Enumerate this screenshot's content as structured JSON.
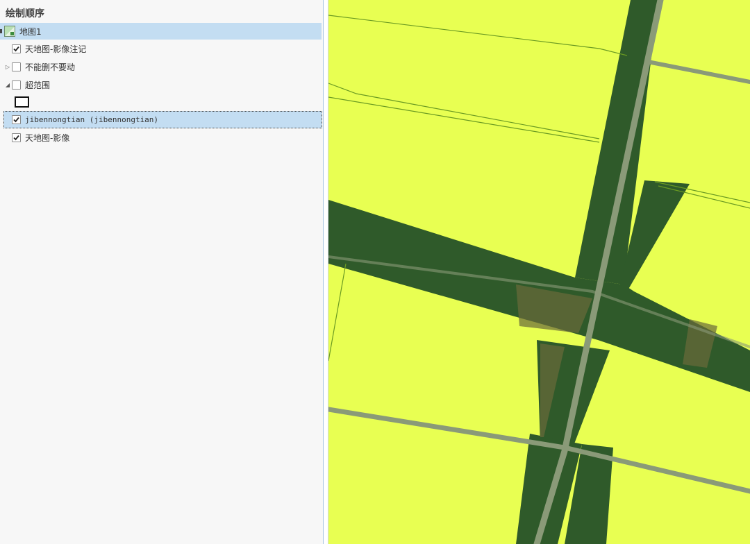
{
  "toc": {
    "title": "绘制顺序",
    "items": [
      {
        "label": "地图1",
        "type": "map",
        "selected": true
      },
      {
        "label": "天地图-影像注记",
        "checked": true
      },
      {
        "label": "不能删不要动",
        "checked": false,
        "expander": "collapsed"
      },
      {
        "label": "超范围",
        "checked": false,
        "expander": "expanded"
      },
      {
        "label": "jibennongtian (jibennongtian)",
        "checked": true,
        "selected": true
      },
      {
        "label": "天地图-影像",
        "checked": true
      }
    ]
  },
  "map": {
    "colors": {
      "parcel": "#e8ff52",
      "field": "#2f5a2a",
      "road": "#8a9a78",
      "boundary": "#6a9a22"
    }
  }
}
